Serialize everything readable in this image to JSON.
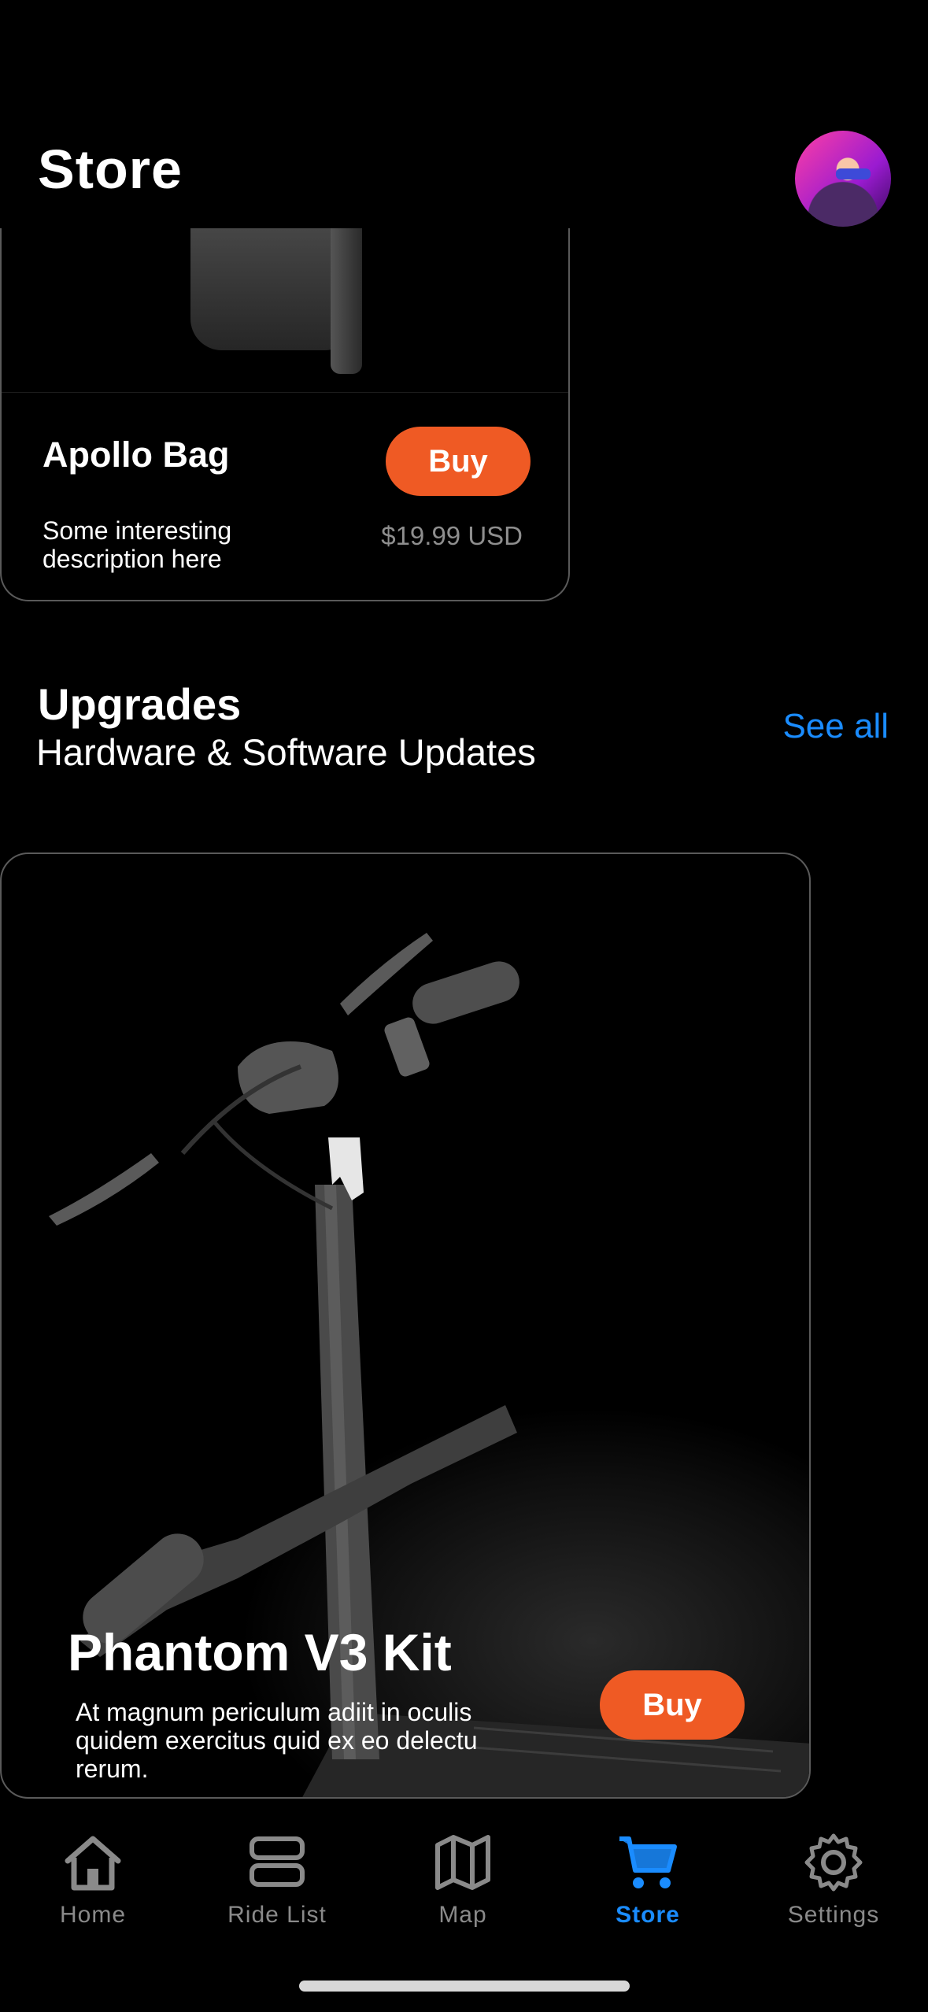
{
  "header": {
    "title": "Store",
    "avatar_alt": "User avatar"
  },
  "accessory_card": {
    "name": "Apollo Bag",
    "buy_label": "Buy",
    "description": "Some interesting description here",
    "price": "$19.99 USD"
  },
  "upgrades": {
    "title": "Upgrades",
    "subtitle": "Hardware & Software Updates",
    "see_all_label": "See all"
  },
  "featured_card": {
    "name": "Phantom V3 Kit",
    "description": "At magnum periculum adiit in oculis quidem exercitus quid ex eo delectu rerum.",
    "buy_label": "Buy"
  },
  "tab_bar": {
    "active": "Store",
    "items": [
      {
        "label": "Home",
        "icon": "home-icon"
      },
      {
        "label": "Ride List",
        "icon": "list-icon"
      },
      {
        "label": "Map",
        "icon": "map-icon"
      },
      {
        "label": "Store",
        "icon": "cart-icon"
      },
      {
        "label": "Settings",
        "icon": "gear-icon"
      }
    ]
  },
  "colors": {
    "background": "#000000",
    "accent_orange": "#ef5a24",
    "link_blue": "#1a8cff",
    "muted_gray": "#8e8e8e"
  }
}
